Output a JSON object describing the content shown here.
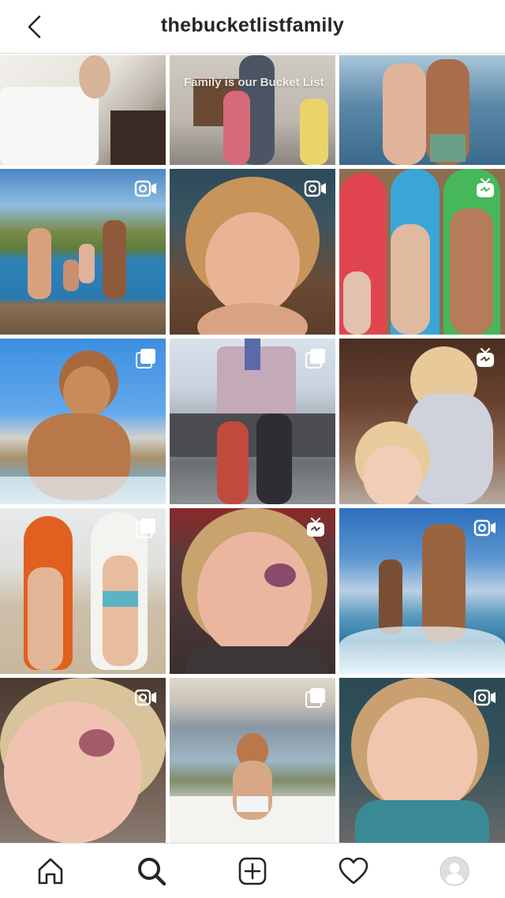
{
  "header": {
    "title": "thebucketlistfamily",
    "back_icon": "chevron-left-icon"
  },
  "grid": {
    "tiles": [
      {
        "name": "post-jump-on-bed",
        "badge": "none",
        "overlay": ""
      },
      {
        "name": "post-family-hug",
        "badge": "none",
        "overlay": "Family is our Bucket List"
      },
      {
        "name": "post-couple-beach",
        "badge": "none",
        "overlay": ""
      },
      {
        "name": "post-dock-jump",
        "badge": "igtv-camera-icon",
        "overlay": ""
      },
      {
        "name": "post-child-face",
        "badge": "igtv-camera-icon",
        "overlay": ""
      },
      {
        "name": "post-surfboards-family",
        "badge": "igtv-tv-icon",
        "overlay": ""
      },
      {
        "name": "post-child-splash",
        "badge": "carousel-icon",
        "overlay": ""
      },
      {
        "name": "post-disneyland",
        "badge": "carousel-icon",
        "overlay": ""
      },
      {
        "name": "post-kids-couch",
        "badge": "igtv-tv-icon",
        "overlay": ""
      },
      {
        "name": "post-kids-surfboards",
        "badge": "carousel-icon",
        "overlay": ""
      },
      {
        "name": "post-black-eye",
        "badge": "igtv-tv-icon",
        "overlay": ""
      },
      {
        "name": "post-surfing",
        "badge": "igtv-camera-icon",
        "overlay": ""
      },
      {
        "name": "post-bruised-face",
        "badge": "igtv-camera-icon",
        "overlay": ""
      },
      {
        "name": "post-window-view",
        "badge": "carousel-icon",
        "overlay": ""
      },
      {
        "name": "post-car-seat",
        "badge": "igtv-camera-icon",
        "overlay": ""
      }
    ]
  },
  "tabbar": {
    "items": [
      {
        "icon": "home-icon"
      },
      {
        "icon": "search-icon",
        "active": true
      },
      {
        "icon": "add-post-icon"
      },
      {
        "icon": "heart-icon"
      },
      {
        "icon": "profile-avatar-icon"
      }
    ]
  },
  "colors": {
    "text": "#262626",
    "border": "#dbdbdb",
    "background": "#ffffff"
  }
}
